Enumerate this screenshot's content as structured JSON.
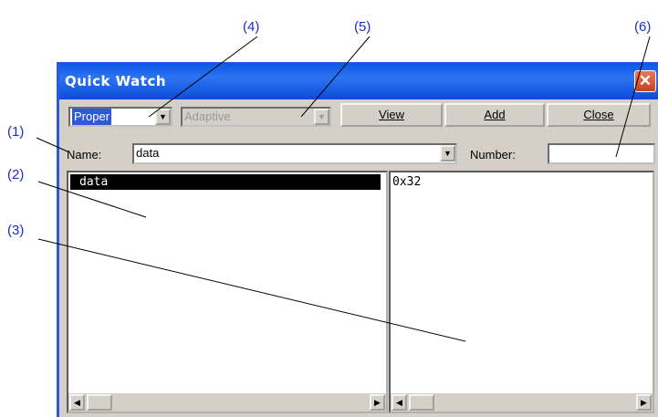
{
  "callouts": [
    "(1)",
    "(2)",
    "(3)",
    "(4)",
    "(5)",
    "(6)"
  ],
  "window": {
    "title": "Quick Watch",
    "close_glyph": "✕"
  },
  "toolbar": {
    "mode_value": "Proper",
    "adaptive_value": "Adaptive",
    "view_label": "View",
    "add_label": "Add",
    "close_label": "Close"
  },
  "fields": {
    "name_label": "Name:",
    "name_value": "data",
    "number_label": "Number:",
    "number_value": ""
  },
  "panes": {
    "symbol_row": "data",
    "value_row": "0x32"
  },
  "icons": {
    "dropdown": "chevron-down-icon",
    "scroll_left": "arrow-left-icon",
    "scroll_right": "arrow-right-icon",
    "close": "close-icon"
  },
  "colors": {
    "callout": "#1a2fbf",
    "title_bar": "#0a56e6",
    "close_button": "#d0542c",
    "window_face": "#d4d0c8",
    "selection": "#000000"
  }
}
